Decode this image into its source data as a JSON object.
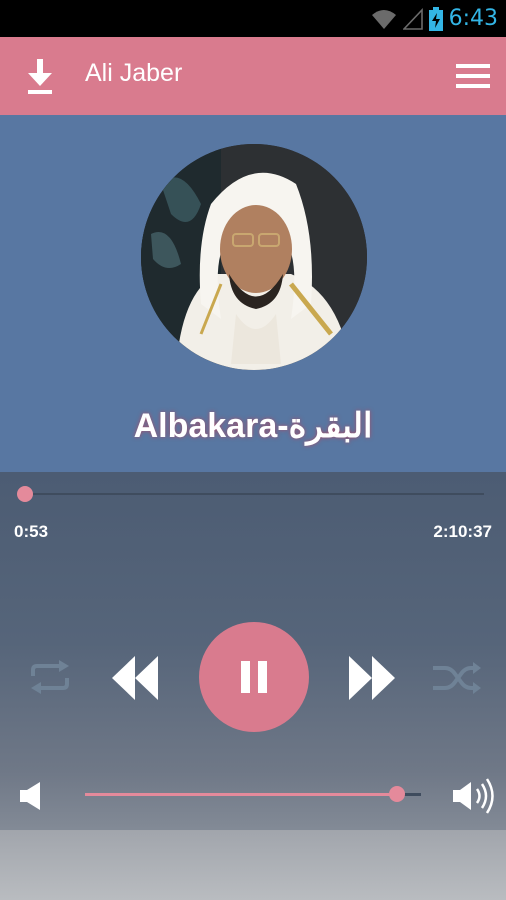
{
  "status_bar": {
    "time": "6:43"
  },
  "toolbar": {
    "title": "Ali Jaber"
  },
  "track": {
    "title": "Albakara-البقرة"
  },
  "player": {
    "current_time": "0:53",
    "duration": "2:10:37",
    "progress_fraction": 0.0068,
    "volume_fraction": 0.93
  },
  "colors": {
    "accent": "#d97b8e",
    "hero_background": "#5877a2",
    "status_icon": "#33b5e5"
  }
}
